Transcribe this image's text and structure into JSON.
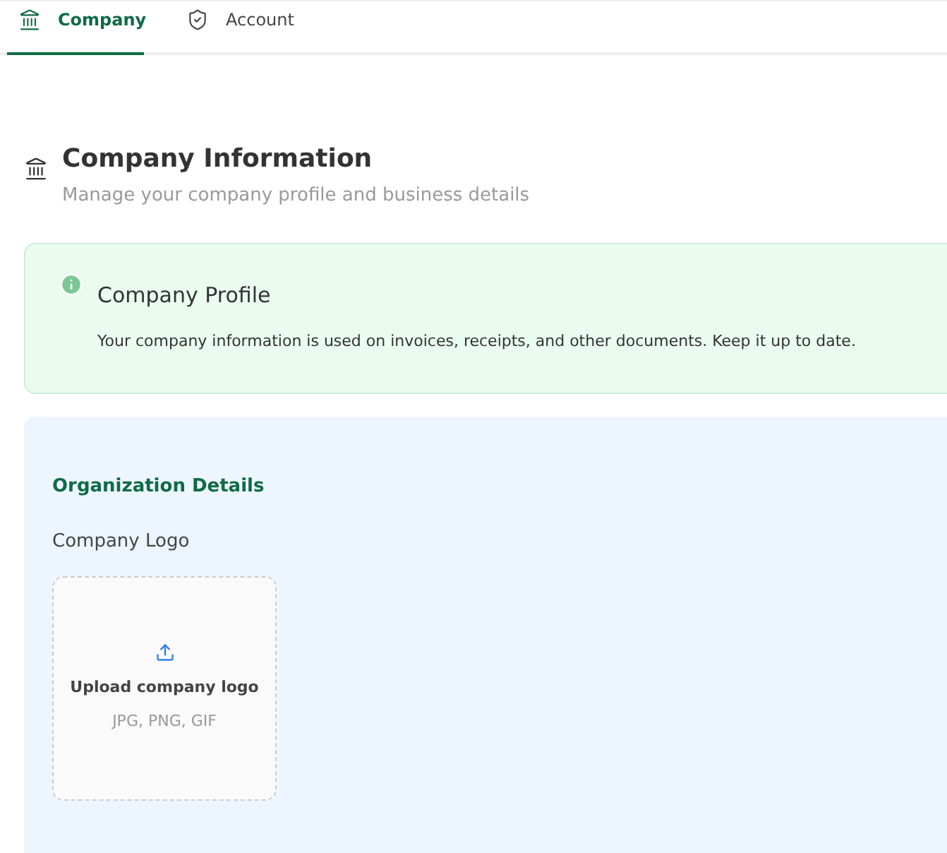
{
  "tabs": [
    {
      "label": "Company",
      "selected": true
    },
    {
      "label": "Account",
      "selected": false
    }
  ],
  "header": {
    "title": "Company Information",
    "subtitle": "Manage your company profile and business details"
  },
  "notice": {
    "title": "Company Profile",
    "text": "Your company information is used on invoices, receipts, and other documents. Keep it up to date."
  },
  "organization": {
    "title": "Organization Details",
    "logo_label": "Company Logo",
    "upload": {
      "label": "Upload company logo",
      "formats": "JPG, PNG, GIF"
    }
  }
}
